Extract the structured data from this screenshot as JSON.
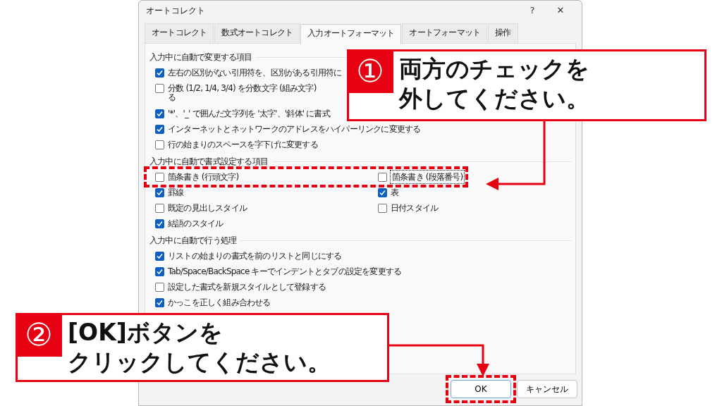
{
  "window": {
    "title": "オートコレクト",
    "help": "?",
    "close": "✕"
  },
  "tabs": [
    {
      "label": "オートコレクト",
      "selected": false
    },
    {
      "label": "数式オートコレクト",
      "selected": false
    },
    {
      "label": "入力オートフォーマット",
      "selected": true
    },
    {
      "label": "オートフォーマット",
      "selected": false
    },
    {
      "label": "操作",
      "selected": false
    }
  ],
  "sections": [
    {
      "title": "入力中に自動で変更する項目",
      "kind": "list",
      "items": [
        {
          "label": "左右の区別がない引用符を、区別がある引用符に",
          "checked": true
        },
        {
          "label": "分数 (1/2, 1/4, 3/4) を分数文字 (組み文字)",
          "continuation": "る",
          "checked": false
        },
        {
          "label": "'*'、'_' で囲んだ文字列を '太字'、'斜体' に書式",
          "checked": true
        },
        {
          "label": "インターネットとネットワークのアドレスをハイパーリンクに変更する",
          "checked": true
        },
        {
          "label": "行の始まりのスペースを字下げに変更する",
          "checked": false
        }
      ]
    },
    {
      "title": "入力中に自動で書式設定する項目",
      "kind": "grid",
      "items": [
        {
          "label": "箇条書き (行頭文字)",
          "checked": false,
          "focused": false
        },
        {
          "label": "箇条書き (段落番号)",
          "checked": false,
          "focused": true
        },
        {
          "label": "罫線",
          "checked": true,
          "focused": false
        },
        {
          "label": "表",
          "checked": true,
          "focused": false
        },
        {
          "label": "既定の見出しスタイル",
          "checked": false,
          "focused": false
        },
        {
          "label": "日付スタイル",
          "checked": false,
          "focused": false
        },
        {
          "label": "結語のスタイル",
          "checked": true,
          "focused": false
        }
      ]
    },
    {
      "title": "入力中に自動で行う処理",
      "kind": "list",
      "items": [
        {
          "label": "リストの始まりの書式を前のリストと同じにする",
          "checked": true
        },
        {
          "label": "Tab/Space/BackSpace キーでインデントとタブの設定を変更する",
          "checked": true
        },
        {
          "label": "設定した書式を新規スタイルとして登録する",
          "checked": false
        },
        {
          "label": "かっこを正しく組み合わせる",
          "checked": true
        }
      ]
    }
  ],
  "buttons": [
    {
      "label": "OK",
      "default": true
    },
    {
      "label": "キャンセル",
      "default": false
    }
  ],
  "callouts": [
    {
      "number": "①",
      "lines": [
        "両方のチェックを",
        "外してください。"
      ]
    },
    {
      "number": "②",
      "lines": [
        "[OK]ボタンを",
        "クリックしてください。"
      ]
    }
  ]
}
